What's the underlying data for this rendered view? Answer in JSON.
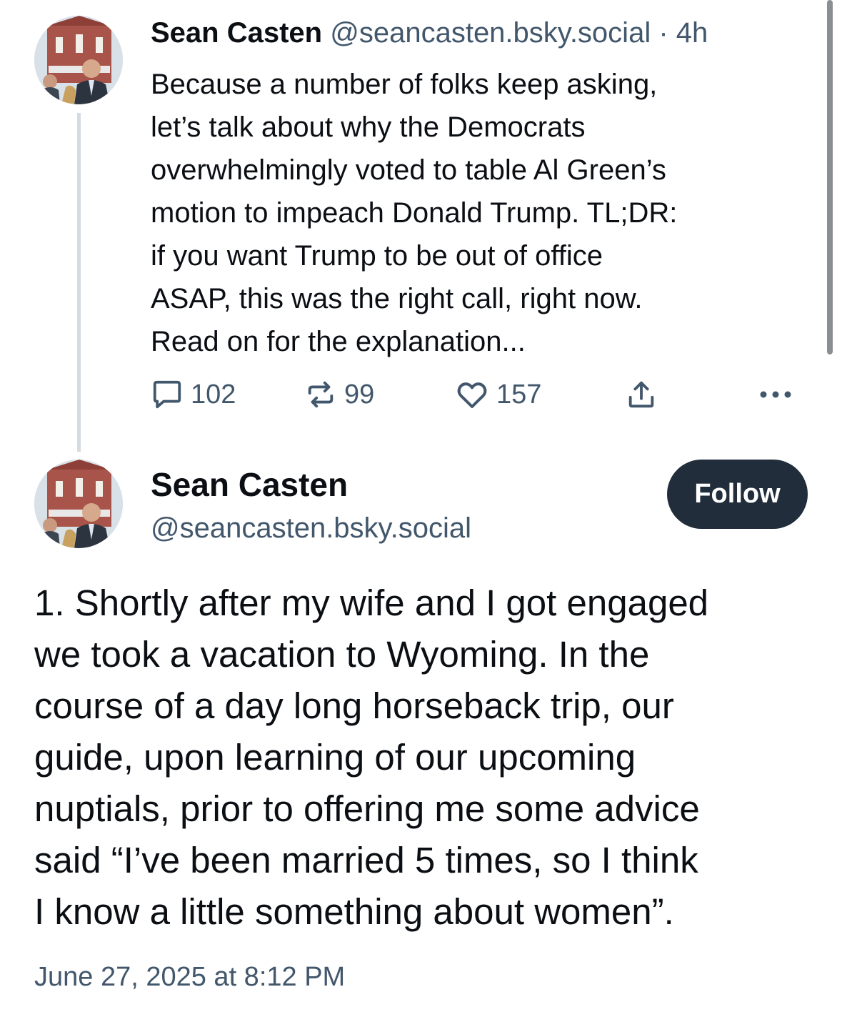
{
  "thread_post": {
    "author_name": "Sean Casten",
    "handle": "@seancasten.bsky.social",
    "separator": "·",
    "age": "4h",
    "text": "Because a number of folks keep asking,\nlet’s talk about why the Democrats\noverwhelmingly voted to table Al Green’s\nmotion to impeach Donald Trump.  TL;DR:\nif you want Trump to be out of office\nASAP, this was the right call, right now.\nRead on for the explanation...",
    "actions": {
      "reply_count": "102",
      "repost_count": "99",
      "like_count": "157"
    },
    "icons": [
      "reply-icon",
      "repost-icon",
      "like-icon",
      "share-icon",
      "more-icon"
    ]
  },
  "main_post": {
    "author_name": "Sean Casten",
    "handle": "@seancasten.bsky.social",
    "follow_label": "Follow",
    "text": "1. Shortly after my wife and I got engaged\nwe took a vacation to Wyoming.  In the\ncourse of a day long horseback trip, our\nguide, upon learning of our upcoming\nnuptials, prior to offering me some advice\nsaid “I’ve been married 5 times, so I think\nI know a little something about women”.",
    "timestamp": "June 27, 2025 at 8:12 PM"
  },
  "colors": {
    "text": "#0b0f14",
    "muted": "#42576c",
    "follow_bg": "#212d3b",
    "thread_line": "#d4dbe2"
  }
}
